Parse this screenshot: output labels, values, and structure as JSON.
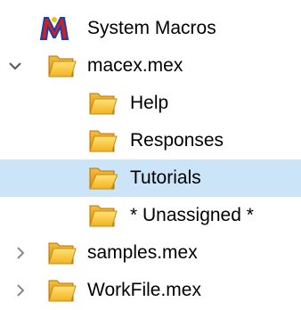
{
  "colors": {
    "selected_row_bg": "#cce4f7",
    "folder_light": "#ffd766",
    "folder_dark": "#e59a0d",
    "chevron": "#5a5a5a"
  },
  "tree": {
    "system_macros": {
      "label": "System Macros",
      "icon": "system-macros-icon"
    },
    "macex": {
      "label": "macex.mex",
      "icon": "folder-icon",
      "expanded": true,
      "children": [
        {
          "label": "Help",
          "icon": "folder-icon"
        },
        {
          "label": "Responses",
          "icon": "folder-icon"
        },
        {
          "label": "Tutorials",
          "icon": "folder-open-icon",
          "selected": true
        },
        {
          "label": "* Unassigned *",
          "icon": "folder-icon"
        }
      ]
    },
    "samples": {
      "label": "samples.mex",
      "icon": "folder-icon",
      "expanded": false
    },
    "workfile": {
      "label": "WorkFile.mex",
      "icon": "folder-icon",
      "expanded": false
    }
  }
}
